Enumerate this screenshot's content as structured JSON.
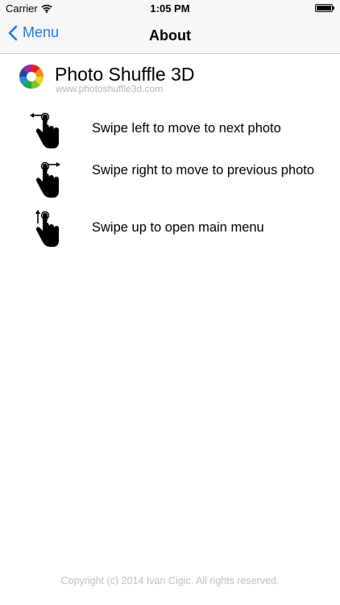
{
  "status_bar": {
    "carrier": "Carrier",
    "time": "1:05 PM",
    "icons": [
      "wifi-icon",
      "battery-icon"
    ]
  },
  "nav": {
    "back_label": "Menu",
    "title": "About"
  },
  "app": {
    "name": "Photo Shuffle 3D",
    "url": "www.photoshuffle3d.com",
    "logo": "color-wheel-logo"
  },
  "gestures": [
    {
      "icon": "swipe-left-icon",
      "text": "Swipe left to move to next photo"
    },
    {
      "icon": "swipe-right-icon",
      "text": "Swipe right to move to previous photo"
    },
    {
      "icon": "swipe-up-icon",
      "text": "Swipe up to open main menu"
    }
  ],
  "footer": {
    "copyright": "Copyright (c) 2014 Ivan Cigic. All rights reserved."
  },
  "colors": {
    "accent": "#1a7cf2",
    "bar_background": "#f7f7f7",
    "footer_text": "#c0c0c0"
  }
}
